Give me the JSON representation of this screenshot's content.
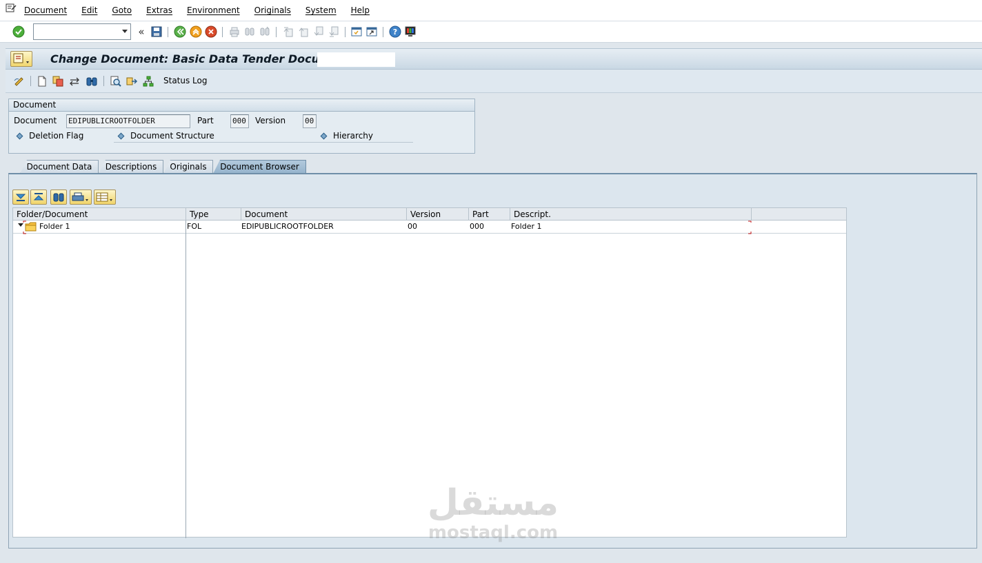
{
  "menu": {
    "items": [
      "Document",
      "Edit",
      "Goto",
      "Extras",
      "Environment",
      "Originals",
      "System",
      "Help"
    ]
  },
  "toolbar": {
    "command_value": "",
    "icons": [
      "enter-icon",
      "back-icon",
      "save-icon",
      "exit-icon",
      "cancel-icon",
      "print-icon",
      "find-icon",
      "find-next-icon",
      "first-page-icon",
      "previous-page-icon",
      "next-page-icon",
      "last-page-icon",
      "new-session-icon",
      "shortcut-icon",
      "help-icon",
      "customize-layout-icon"
    ]
  },
  "title": {
    "text": "Change Document: Basic Data Tender Docum"
  },
  "app_toolbar": {
    "status_log_label": "Status Log"
  },
  "document_group": {
    "title": "Document",
    "document_label": "Document",
    "document_value": "EDIPUBLICROOTFOLDER",
    "part_label": "Part",
    "part_value": "000",
    "version_label": "Version",
    "version_value": "00",
    "deletion_flag_label": "Deletion Flag",
    "document_structure_label": "Document Structure",
    "hierarchy_label": "Hierarchy"
  },
  "tabs": [
    {
      "label": "Document Data",
      "active": false
    },
    {
      "label": "Descriptions",
      "active": false
    },
    {
      "label": "Originals",
      "active": false
    },
    {
      "label": "Document Browser",
      "active": true
    }
  ],
  "browser": {
    "columns": [
      "Folder/Document",
      "Type",
      "Document",
      "Version",
      "Part",
      "Descript."
    ],
    "rows": [
      {
        "folder": "Folder 1",
        "type": "FOL",
        "document": "EDIPUBLICROOTFOLDER",
        "version": "00",
        "part": "000",
        "description": "Folder 1"
      }
    ]
  },
  "watermark": {
    "arabic": "مستقل",
    "latin": "mostaql.com"
  }
}
